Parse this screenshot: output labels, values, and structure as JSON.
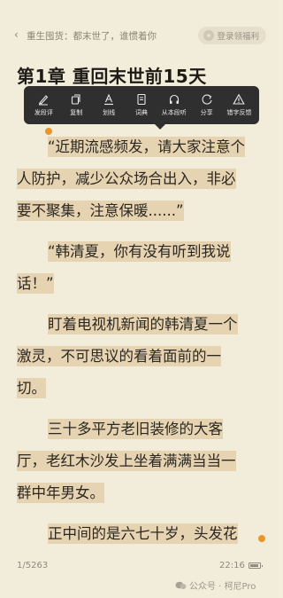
{
  "topbar": {
    "back_icon": "chevron-left-icon",
    "book_title": "重生囤货：都末世了，谁惯着你",
    "login_label": "登录领福利"
  },
  "chapter": {
    "title": "第1章  重回末世前15天"
  },
  "toolbar": {
    "items": [
      {
        "icon": "pen-icon",
        "label": "发段评"
      },
      {
        "icon": "copy-icon",
        "label": "复制"
      },
      {
        "icon": "underline-icon",
        "label": "划线"
      },
      {
        "icon": "dictionary-icon",
        "label": "词典"
      },
      {
        "icon": "headphones-icon",
        "label": "从本段听"
      },
      {
        "icon": "share-icon",
        "label": "分享"
      },
      {
        "icon": "warning-icon",
        "label": "错字反馈"
      }
    ]
  },
  "content": {
    "lines": [
      "“近期流感频发，请大家注意个",
      "人防护，减少公众场合出入，非必",
      "要不聚集，注意保暖......”",
      "“韩清夏，你有没有听到我说",
      "话！”",
      "盯着电视机新闻的韩清夏一个",
      "激灵，不可思议的看着面前的一",
      "切。",
      "三十多平方老旧装修的大客",
      "厅，老红木沙发上坐着满满当当一",
      "群中年男女。",
      "正中间的是六七十岁，头发花"
    ]
  },
  "footer": {
    "page_progress": "1/5263",
    "time": "22:16",
    "watermark": "公众号 · 柯尼Pro"
  },
  "colors": {
    "highlight": "#e6d3b2",
    "handle": "#e8962b",
    "background": "#f2ecda"
  }
}
